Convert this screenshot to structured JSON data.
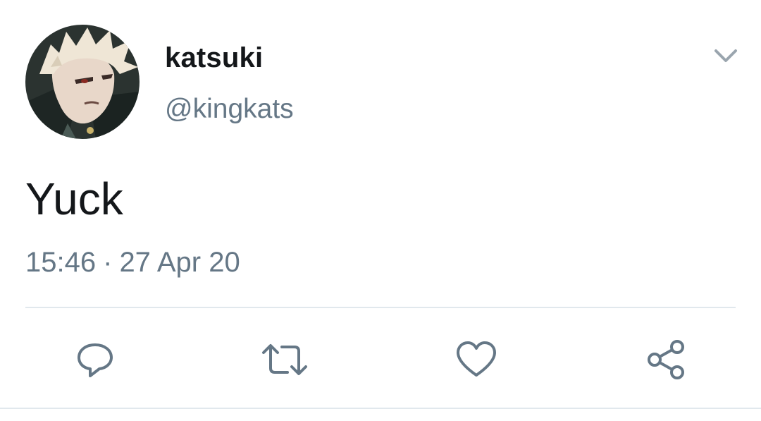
{
  "tweet": {
    "author": {
      "display_name": "katsuki",
      "handle": "@kingkats",
      "avatar_icon": "profile-avatar"
    },
    "text": "Yuck",
    "time": "15:46",
    "separator": "·",
    "date": "27 Apr 20",
    "menu_icon": "chevron-down-icon"
  },
  "actions": [
    {
      "name": "reply",
      "icon": "reply-icon"
    },
    {
      "name": "retweet",
      "icon": "retweet-icon"
    },
    {
      "name": "like",
      "icon": "heart-icon"
    },
    {
      "name": "share",
      "icon": "share-icon"
    }
  ],
  "colors": {
    "text_primary": "#14171a",
    "text_secondary": "#657786",
    "divider": "#e1e8ed",
    "icon": "#657786"
  }
}
